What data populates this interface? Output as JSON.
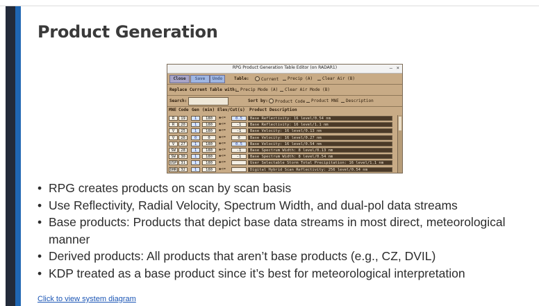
{
  "slide": {
    "title": "Product Generation",
    "link": "Click to view system diagram",
    "bullets": [
      "RPG creates products on scan by scan basis",
      "Use Reflectivity, Radial Velocity, Spectrum Width, and dual-pol data streams",
      "Base products: Products that depict base data streams in most direct, meteorological manner",
      "Derived products: All products that aren’t base products (e.g., CZ, DVIL)",
      "KDP treated as a base product since it’s best for meteorological interpretation"
    ]
  },
  "app": {
    "window_title": "RPG Product Generation Table Editor (on RADAR1)",
    "minimize": "–",
    "close": "×",
    "close_button": "Close",
    "save_button": "Save",
    "undo_button": "Undo",
    "table_label": "Table:",
    "table_options": [
      "Current",
      "Precip (A)",
      "Clear Air (B)"
    ],
    "replace_label": "Replace Current Table with:",
    "replace_options": [
      "Precip Mode (A)",
      "Clear Air Mode (B)"
    ],
    "search_label": "Search:",
    "sort_label": "Sort by:",
    "sort_options": [
      "Product Code",
      "Product MNE",
      "Description"
    ],
    "headers": [
      "MNE",
      "Code",
      "Gen",
      "(min)",
      "Elev/Cut(s)",
      "Product Description"
    ],
    "rows": [
      {
        "mne": "R",
        "code": "19",
        "gen": "1",
        "min": "180",
        "elev": "0.5",
        "desc": "Base Reflectivity: 16 level/0.54 nm"
      },
      {
        "mne": "R",
        "code": "20",
        "gen": "1",
        "min": "180",
        "elev": "-1",
        "desc": "Base Reflectivity: 16 level/1.1 nm"
      },
      {
        "mne": "V",
        "code": "25",
        "gen": "1",
        "min": "180",
        "elev": "-1",
        "desc": "Base Velocity: 16 level/0.13 nm"
      },
      {
        "mne": "V",
        "code": "26",
        "gen": "0",
        "min": "0",
        "elev": "0",
        "desc": "Base Velocity: 16 level/0.27 nm"
      },
      {
        "mne": "V",
        "code": "27",
        "gen": "1",
        "min": "180",
        "elev": "0.5",
        "desc": "Base Velocity: 16 level/0.54 nm"
      },
      {
        "mne": "SW",
        "code": "28",
        "gen": "1",
        "min": "180",
        "elev": "-1",
        "desc": "Base Spectrum Width: 8 level/0.13 nm"
      },
      {
        "mne": "SW",
        "code": "30",
        "gen": "1",
        "min": "180",
        "elev": "-1",
        "desc": "Base Spectrum Width: 8 level/0.54 nm"
      },
      {
        "mne": "USP",
        "code": "31",
        "gen": "1",
        "min": "180",
        "elev": "",
        "desc": "User Selectable Storm Total Precipitation: 16 level/1.1 nm"
      },
      {
        "mne": "DHR",
        "code": "32",
        "gen": "1",
        "min": "180",
        "elev": "",
        "desc": "Digital Hybrid Scan Reflectivity: 256 level/0.54 nm"
      }
    ]
  }
}
